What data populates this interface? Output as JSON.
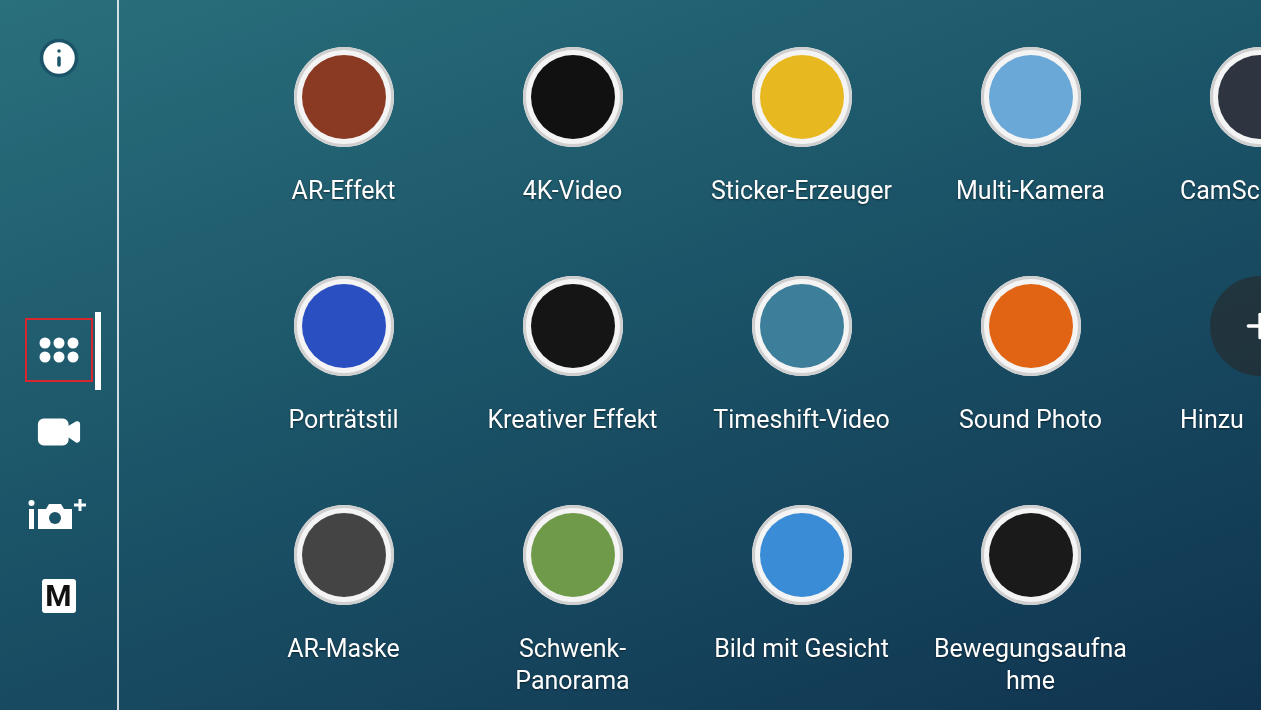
{
  "sidebar": {
    "items": [
      {
        "kind": "info",
        "selected": false
      },
      {
        "kind": "grid",
        "selected": true
      },
      {
        "kind": "video",
        "selected": false
      },
      {
        "kind": "camera-add",
        "selected": false
      },
      {
        "kind": "manual",
        "label": "M",
        "selected": false
      }
    ]
  },
  "apps": [
    {
      "kind": "app",
      "label": "AR-Effekt",
      "color": "#8a3a22"
    },
    {
      "kind": "app",
      "label": "4K-Video",
      "color": "#111111"
    },
    {
      "kind": "app",
      "label": "Sticker-Erzeuger",
      "color": "#e8b820"
    },
    {
      "kind": "app",
      "label": "Multi-Kamera",
      "color": "#6aa8d8"
    },
    {
      "kind": "app",
      "label": "CamSc",
      "color": "#2e3440"
    },
    {
      "kind": "app",
      "label": "Porträtstil",
      "color": "#2a4fc0"
    },
    {
      "kind": "app",
      "label": "Kreativer Effekt",
      "color": "#151515"
    },
    {
      "kind": "app",
      "label": "Timeshift-Video",
      "color": "#3d7f9a"
    },
    {
      "kind": "app",
      "label": "Sound Photo",
      "color": "#e06414"
    },
    {
      "kind": "add",
      "label": "Hinzu"
    },
    {
      "kind": "app",
      "label": "AR-Maske",
      "color": "#444444"
    },
    {
      "kind": "app",
      "label": "Schwenk-Panorama",
      "color": "#6f9a4a"
    },
    {
      "kind": "app",
      "label": "Bild mit Gesicht",
      "color": "#3a8cd6"
    },
    {
      "kind": "app",
      "label": "Bewegungsaufnahme",
      "color": "#1a1a1a"
    }
  ]
}
